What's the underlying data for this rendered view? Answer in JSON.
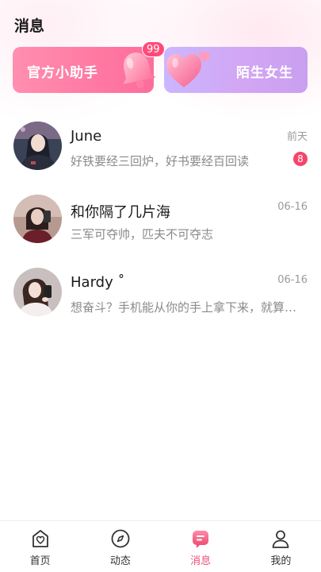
{
  "header": {
    "title": "消息"
  },
  "banners": {
    "assistant": {
      "label": "官方小助手",
      "badge": "99"
    },
    "strangers": {
      "label": "陌生女生"
    }
  },
  "chats": [
    {
      "name": "June",
      "preview": "好铁要经三回炉，好书要经百回读",
      "time": "前天",
      "unread": "8"
    },
    {
      "name": "和你隔了几片海",
      "preview": "三军可夺帅，匹夫不可夺志",
      "time": "06-16"
    },
    {
      "name": "Hardy ˚",
      "preview": "想奋斗？手机能从你的手上拿下来，就算是成功的第一步",
      "time": "06-16"
    }
  ],
  "tabbar": {
    "items": [
      {
        "label": "首页",
        "icon": "home-heart-icon"
      },
      {
        "label": "动态",
        "icon": "compass-icon"
      },
      {
        "label": "消息",
        "icon": "message-icon"
      },
      {
        "label": "我的",
        "icon": "profile-icon"
      }
    ],
    "active": 2
  },
  "colors": {
    "accent": "#f04f76",
    "unread_badge": "#f5456a"
  }
}
